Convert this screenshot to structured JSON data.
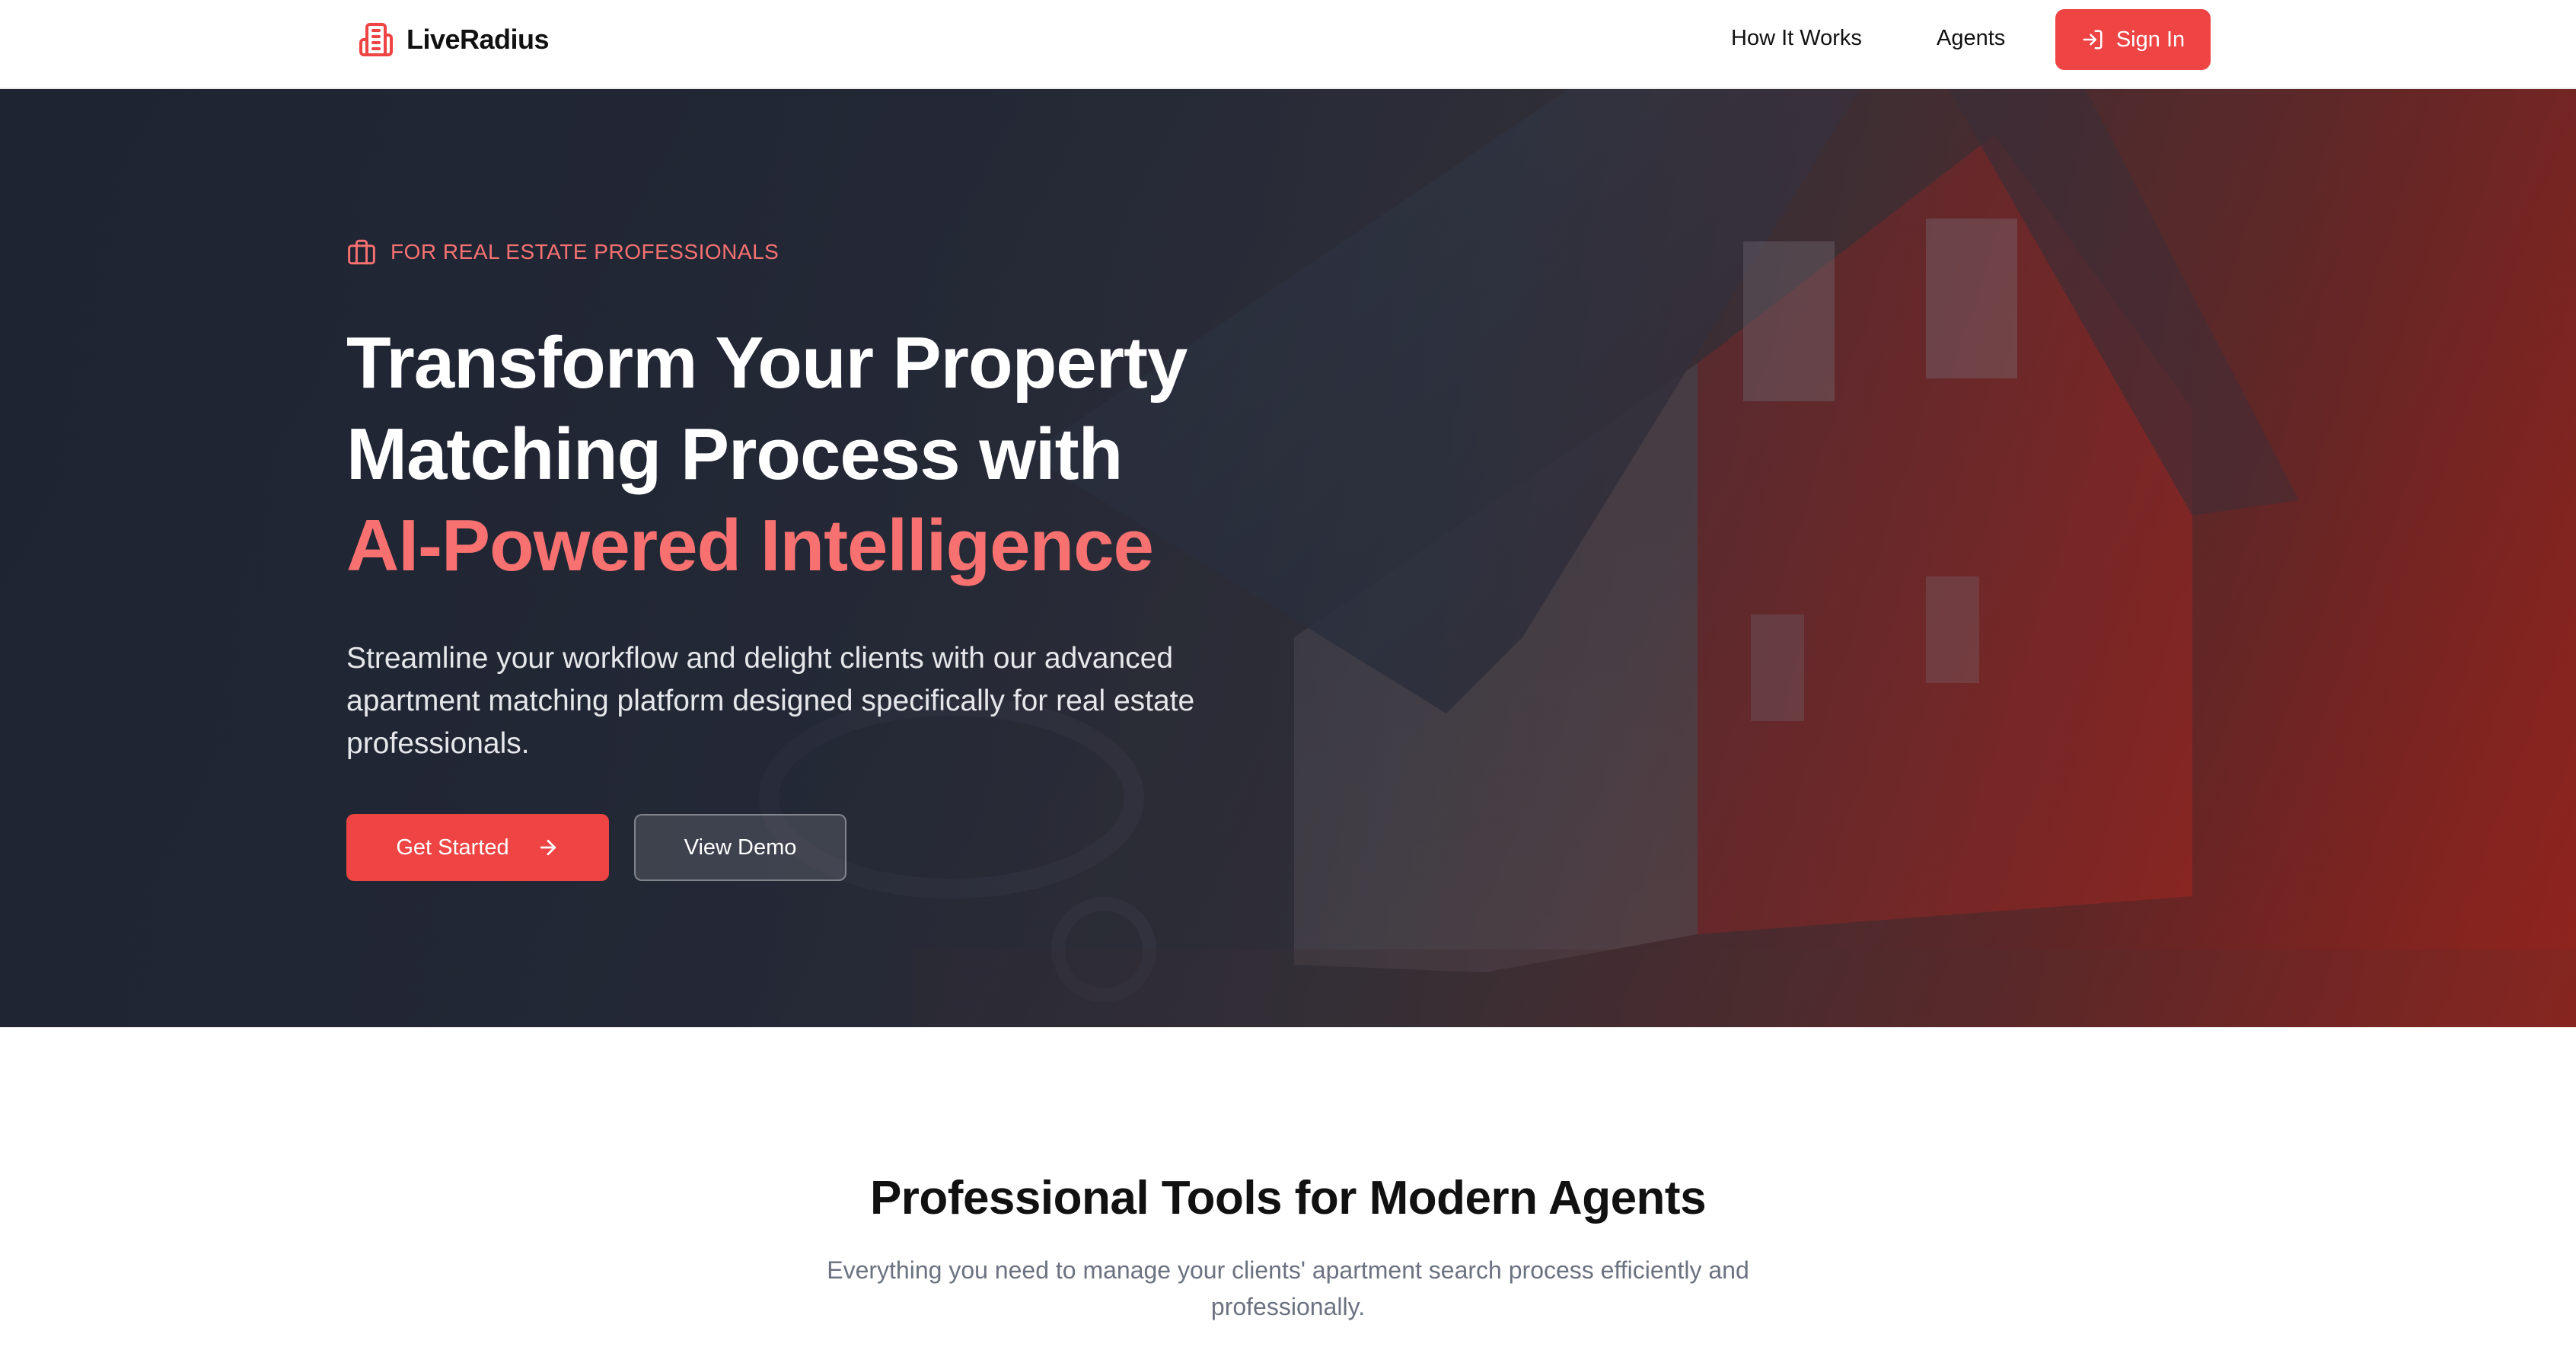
{
  "brand": {
    "name": "LiveRadius",
    "icon": "building-icon",
    "accent_color": "#ef4444"
  },
  "nav": {
    "links": [
      {
        "label": "How It Works"
      },
      {
        "label": "Agents"
      }
    ],
    "signin": {
      "label": "Sign In",
      "icon": "log-in-icon"
    }
  },
  "hero": {
    "eyebrow": {
      "label": "FOR REAL ESTATE PROFESSIONALS",
      "icon": "briefcase-icon"
    },
    "headline": {
      "line1": "Transform Your Property",
      "line2": "Matching Process with",
      "line3": "AI-Powered Intelligence"
    },
    "subtext": "Streamline your workflow and delight clients with our advanced apartment matching platform designed specifically for real estate professionals.",
    "primary_button": {
      "label": "Get Started",
      "icon": "arrow-right-icon"
    },
    "secondary_button": {
      "label": "View Demo"
    },
    "highlight_color": "#f87171"
  },
  "features": {
    "title": "Professional Tools for Modern Agents",
    "subtitle": "Everything you need to manage your clients' apartment search process efficiently and professionally."
  }
}
